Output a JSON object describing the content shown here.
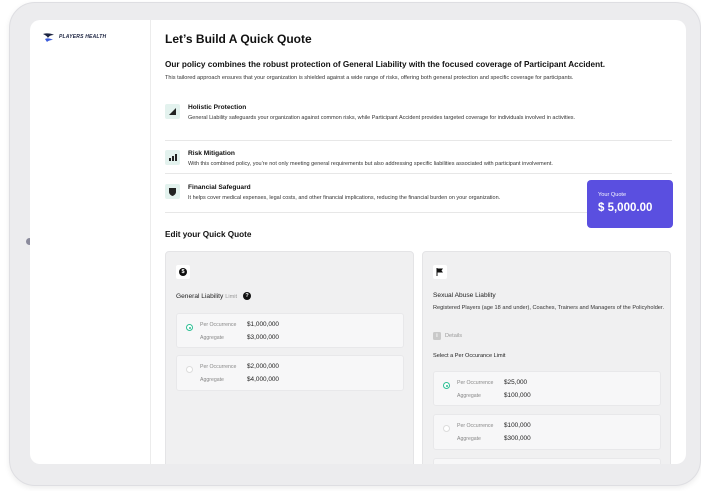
{
  "brand": {
    "logo_text": "PLAYERS HEALTH"
  },
  "page": {
    "title": "Let’s Build A Quick Quote",
    "headline": "Our policy combines the robust protection of General Liability with the focused coverage of Participant Accident.",
    "intro": "This tailored approach ensures that your organization is shielded against a wide range of risks, offering both general protection and specific coverage for participants."
  },
  "features": [
    {
      "icon": "shield-image-icon",
      "title": "Holistic Protection",
      "desc": "General Liability safeguards your organization against common risks, while Participant Accident provides targeted coverage for individuals involved in activities."
    },
    {
      "icon": "bar-chart-icon",
      "title": "Risk Mitigation",
      "desc": "With this combined policy, you’re not only meeting general requirements but also addressing specific liabilities associated with participant involvement."
    },
    {
      "icon": "shield-check-icon",
      "title": "Financial Safeguard",
      "desc": "It helps cover medical expenses, legal costs, and other financial implications, reducing the financial burden on your organization."
    }
  ],
  "quote": {
    "label": "Your Quote",
    "amount": "$ 5,000.00",
    "color": "#5a4fe0"
  },
  "edit": {
    "title": "Edit your Quick Quote"
  },
  "general_liability": {
    "icon": "dollar-icon",
    "name": "General Liability",
    "sub": "Limit",
    "options": [
      {
        "selected": true,
        "occ_label": "Per Occurrence",
        "occ_value": "$1,000,000",
        "agg_label": "Aggregate",
        "agg_value": "$3,000,000"
      },
      {
        "selected": false,
        "occ_label": "Per Occurrence",
        "occ_value": "$2,000,000",
        "agg_label": "Aggregate",
        "agg_value": "$4,000,000"
      }
    ]
  },
  "sexual_abuse": {
    "icon": "flag-icon",
    "name": "Sexual Abuse Liablity",
    "desc": "Registered Players (age 18 and under), Coaches, Trainers and Managers of the Policyholder.",
    "details_label": "Details",
    "select_label": "Select a Per Occurance Limit",
    "options": [
      {
        "selected": true,
        "occ_label": "Per Occurrence",
        "occ_value": "$25,000",
        "agg_label": "Aggregate",
        "agg_value": "$100,000"
      },
      {
        "selected": false,
        "occ_label": "Per Occurrence",
        "occ_value": "$100,000",
        "agg_label": "Aggregate",
        "agg_value": "$300,000"
      }
    ]
  },
  "colors": {
    "accent": "#5a4fe0",
    "radio_selected": "#2ebf94"
  }
}
